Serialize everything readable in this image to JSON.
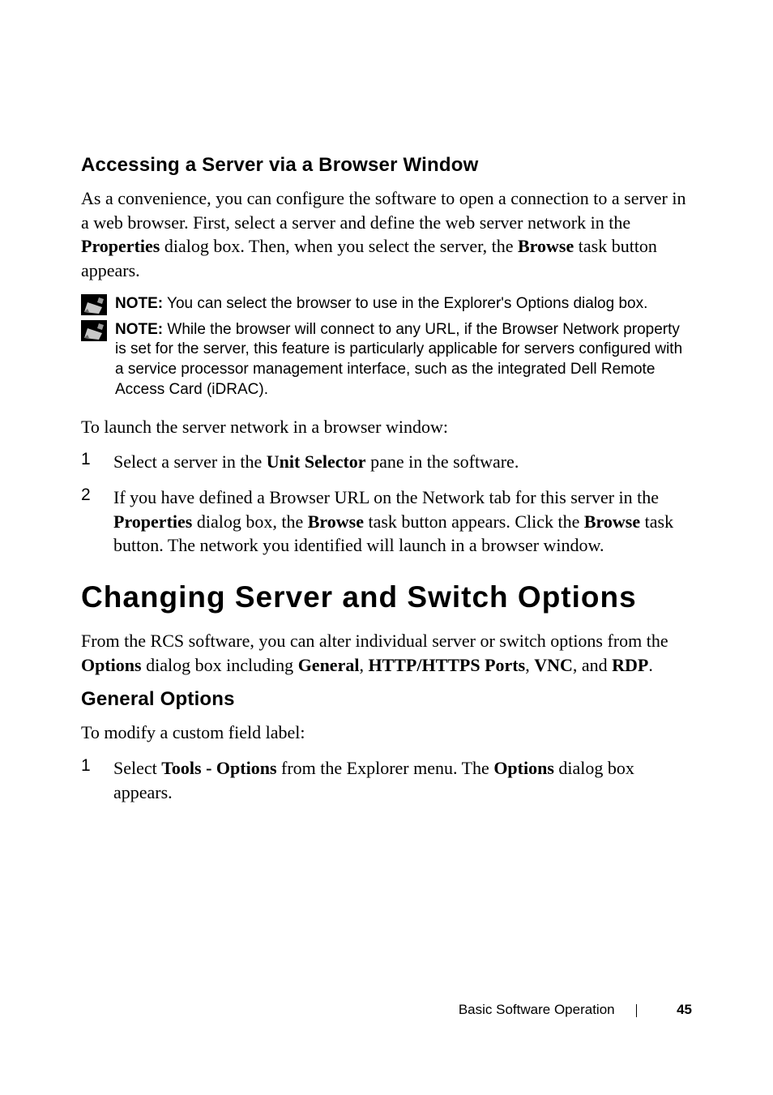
{
  "h3_accessing": "Accessing a Server via a Browser Window",
  "intro_p": {
    "t1": "As a convenience, you can configure the software to open a connection to a server in a web browser. First, select a server and define the web server network in the ",
    "b1": "Properties",
    "t2": " dialog box. Then, when you select the server, the ",
    "b2": "Browse",
    "t3": " task button appears."
  },
  "note1": {
    "label": "NOTE:",
    "text": " You can select the browser to use in the Explorer's Options dialog box."
  },
  "note2": {
    "label": "NOTE:",
    "text": " While the browser will connect to any URL, if the Browser Network property is set for the server, this feature is particularly applicable for servers configured with a service processor management interface, such as the integrated Dell Remote Access Card (iDRAC)."
  },
  "launch_p": "To launch the server network in a browser window:",
  "steps1": {
    "s1": {
      "num": "1",
      "t1": "Select a server in the ",
      "b1": "Unit Selector",
      "t2": " pane in the software."
    },
    "s2": {
      "num": "2",
      "t1": "If you have defined a Browser URL on the Network tab for this server in the ",
      "b1": "Properties",
      "t2": " dialog box, the ",
      "b2": "Browse",
      "t3": " task button appears. Click the ",
      "b3": "Browse",
      "t4": " task button. The network you identified will launch in a browser window."
    }
  },
  "h1_changing": "Changing Server and Switch Options",
  "changing_p": {
    "t1": "From the RCS software, you can alter individual server or switch options from the ",
    "b1": "Options",
    "t2": " dialog box including ",
    "b2": "General",
    "t3": ", ",
    "b3": "HTTP/HTTPS Ports",
    "t4": ", ",
    "b4": "VNC",
    "t5": ", and ",
    "b5": "RDP",
    "t6": "."
  },
  "h3_general": "General Options",
  "modify_p": "To modify a custom field label:",
  "steps2": {
    "s1": {
      "num": "1",
      "t1": "Select ",
      "b1": "Tools - Options",
      "t2": " from the Explorer menu. The ",
      "b2": "Options",
      "t3": " dialog box appears."
    }
  },
  "footer": {
    "section": "Basic Software Operation",
    "page": "45"
  }
}
